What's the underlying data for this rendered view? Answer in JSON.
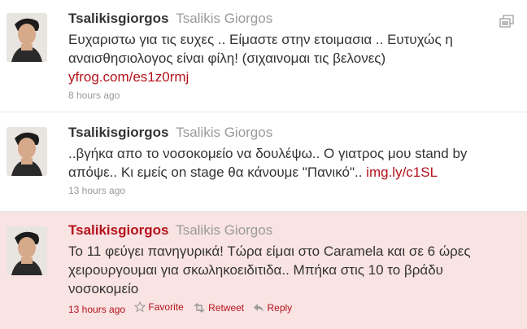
{
  "tweets": [
    {
      "screen_name": "Tsalikisgiorgos",
      "full_name": "Tsalikis Giorgos",
      "text": "Ευχαριστω για τις ευχες .. Είμαστε στην ετοιμασια .. Ευτυχώς η αναισθησιολογος είναι φίλη! (σιχαινομαι τις βελονες)",
      "link": "yfrog.com/es1z0rmj",
      "time": "8 hours ago"
    },
    {
      "screen_name": "Tsalikisgiorgos",
      "full_name": "Tsalikis Giorgos",
      "text": "..βγήκα απο το νοσοκομείο να δουλέψω.. Ο γιατρος μου stand by απόψε.. Κι εμείς on stage θα κάνουμε \"Πανικό\"..",
      "link": "img.ly/c1SL",
      "time": "13 hours ago"
    },
    {
      "screen_name": "Tsalikisgiorgos",
      "full_name": "Tsalikis Giorgos",
      "text": "Το 11 φεύγει πανηγυρικά! Τώρα είμαι στο Caramela και σε 6 ώρες χειρουργουμαι για σκωληκοειδιτιδα.. Μπήκα στις 10 το βράδυ νοσοκομείο",
      "time": "13 hours ago",
      "actions": {
        "favorite": "Favorite",
        "retweet": "Retweet",
        "reply": "Reply"
      }
    }
  ],
  "icons": {
    "corner": "gallery-icon",
    "favorite": "star-icon",
    "retweet": "retweet-icon",
    "reply": "reply-icon"
  },
  "colors": {
    "accent": "#b5121b",
    "highlight_bg": "#f9e3e3",
    "muted": "#999999"
  }
}
